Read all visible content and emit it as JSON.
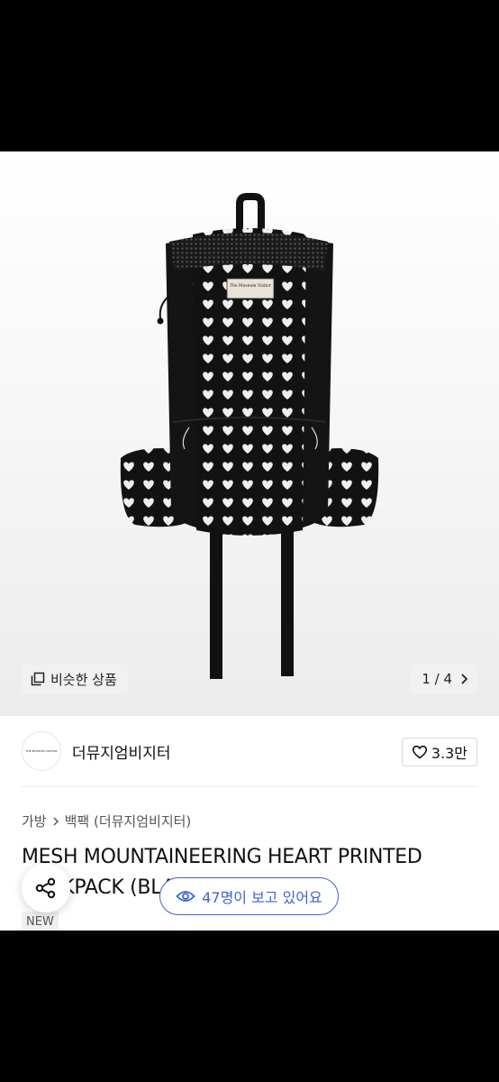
{
  "hero": {
    "similar_button": "비슷한 상품",
    "page_indicator": "1 / 4",
    "label_text": "The Museum Visitor"
  },
  "brand": {
    "logo_text": "THE MUSEUM VISITOR",
    "name": "더뮤지엄비지터",
    "likes": "3.3만"
  },
  "breadcrumb": {
    "category": "가방",
    "subcategory": "백팩 (더뮤지엄비지터)"
  },
  "product": {
    "title": "MESH MOUNTAINEERING HEART PRINTED BACKPACK (BLACK)",
    "badge": "NEW"
  },
  "viewers": {
    "text": "47명이 보고 있어요"
  },
  "icons": {
    "similar": "copy-icon",
    "next": "chevron-right-icon",
    "like": "heart-outline-icon",
    "breadcrumb_sep": "chevron-right-icon",
    "share": "share-icon",
    "viewers": "eye-icon"
  },
  "colors": {
    "accent": "#3e63d8",
    "bag": "#111111",
    "hearts": "#eeeeee"
  }
}
